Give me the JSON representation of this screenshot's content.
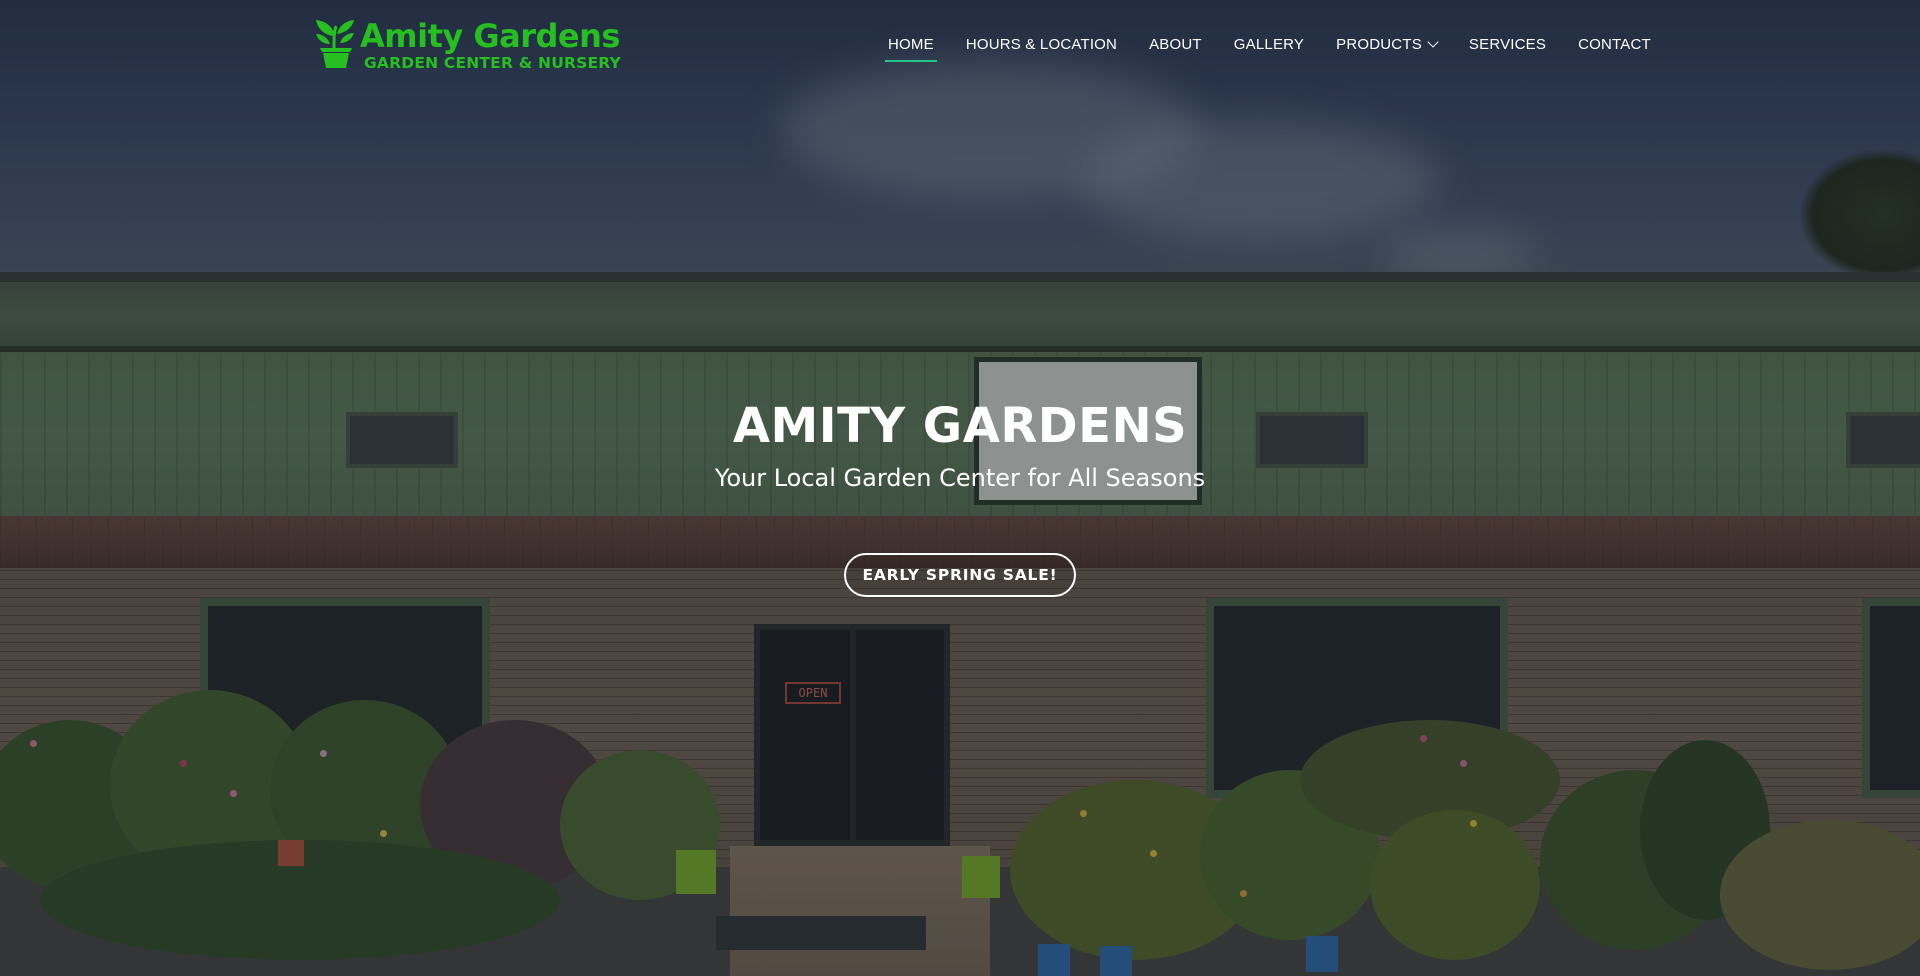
{
  "brand": {
    "title": "Amity Gardens",
    "subtitle": "GARDEN CENTER & NURSERY",
    "color": "#25c01f"
  },
  "nav": {
    "items": [
      {
        "label": "HOME",
        "active": true
      },
      {
        "label": "HOURS & LOCATION"
      },
      {
        "label": "ABOUT"
      },
      {
        "label": "GALLERY"
      },
      {
        "label": "PRODUCTS",
        "has_dropdown": true
      },
      {
        "label": "SERVICES"
      },
      {
        "label": "CONTACT"
      }
    ],
    "active_underline_color": "#24c38a"
  },
  "hero": {
    "title": "AMITY GARDENS",
    "subtitle": "Your Local Garden Center for All Seasons",
    "cta_label": "EARLY SPRING SALE!"
  },
  "background": {
    "storefront_sign_text": "OPEN"
  }
}
